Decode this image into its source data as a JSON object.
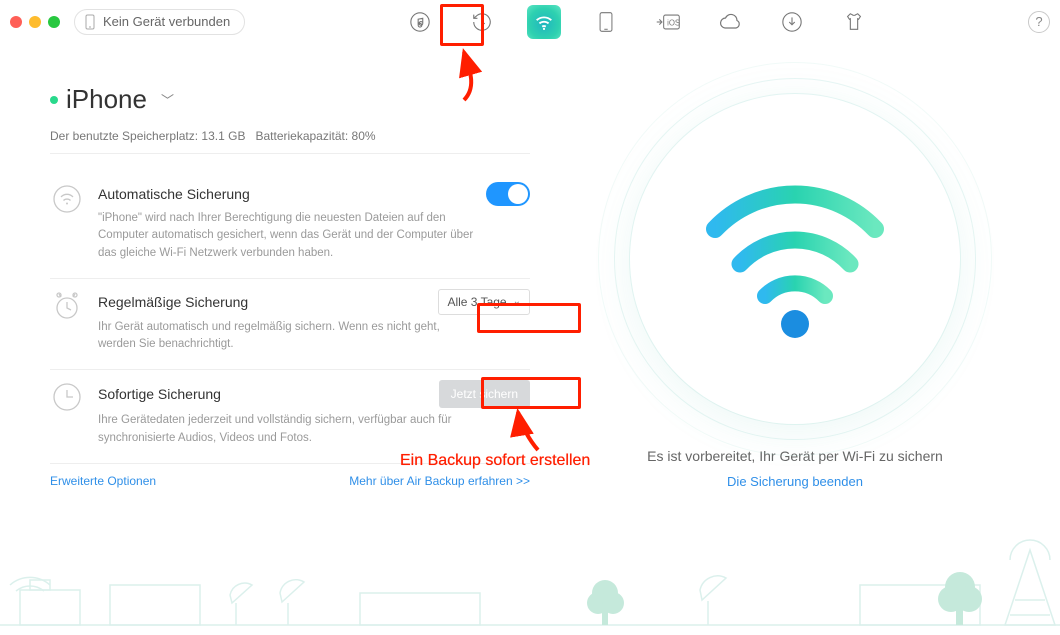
{
  "titlebar": {
    "device_status": "Kein Gerät verbunden",
    "help": "?"
  },
  "nav": {
    "items": [
      "music",
      "history",
      "wifi-backup",
      "phone",
      "to-ios",
      "icloud",
      "download",
      "skin"
    ]
  },
  "device": {
    "name": "iPhone",
    "storage_label": "Der benutzte Speicherplatz: 13.1 GB",
    "battery_label": "Batteriekapazität: 80%"
  },
  "sections": {
    "auto": {
      "title": "Automatische Sicherung",
      "desc": "\"iPhone\" wird nach Ihrer Berechtigung die neuesten Dateien auf den Computer automatisch gesichert, wenn das Gerät und der Computer über das gleiche Wi-Fi Netzwerk verbunden haben."
    },
    "regular": {
      "title": "Regelmäßige Sicherung",
      "desc": "Ihr Gerät automatisch und regelmäßig sichern. Wenn es nicht geht, werden Sie benachrichtigt.",
      "interval": "Alle 3 Tage"
    },
    "instant": {
      "title": "Sofortige Sicherung",
      "desc": "Ihre Gerätedaten jederzeit und vollständig sichern, verfügbar auch für synchronisierte Audios, Videos und Fotos.",
      "button": "Jetzt sichern"
    }
  },
  "links": {
    "advanced": "Erweiterte Optionen",
    "learn_more": "Mehr über Air Backup erfahren >>"
  },
  "right": {
    "ready": "Es ist vorbereitet, Ihr Gerät per Wi-Fi zu sichern",
    "end": "Die Sicherung beenden"
  },
  "annotation": {
    "caption": "Ein Backup sofort erstellen"
  }
}
